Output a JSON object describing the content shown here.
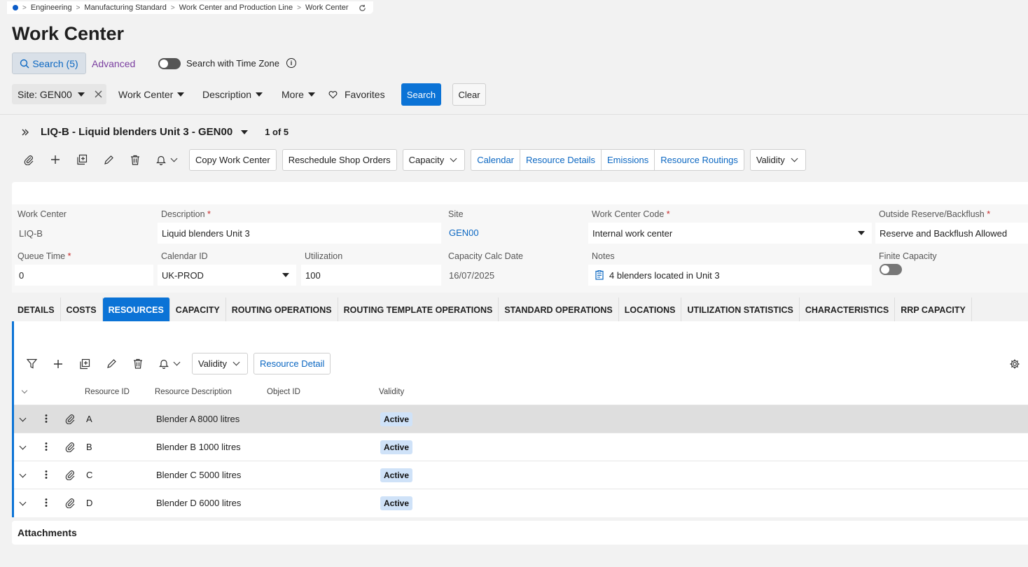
{
  "breadcrumb": [
    "Engineering",
    "Manufacturing Standard",
    "Work Center and Production Line",
    "Work Center"
  ],
  "page_title": "Work Center",
  "search": {
    "search_tab": "Search (5)",
    "advanced": "Advanced",
    "timezone_label": "Search with Time Zone",
    "info": "i"
  },
  "filters": {
    "site_chip": "Site: GEN00",
    "work_center": "Work Center",
    "description": "Description",
    "more": "More",
    "favorites": "Favorites",
    "search_btn": "Search",
    "clear_btn": "Clear"
  },
  "record": {
    "title": "LIQ-B - Liquid blenders Unit 3 - GEN00",
    "count": "1 of 5"
  },
  "toolbar": {
    "copy_work_center": "Copy Work Center",
    "reschedule": "Reschedule Shop Orders",
    "capacity": "Capacity",
    "links": [
      "Calendar",
      "Resource Details",
      "Emissions",
      "Resource Routings"
    ],
    "validity": "Validity"
  },
  "form": {
    "work_center": {
      "label": "Work Center",
      "value": "LIQ-B"
    },
    "description": {
      "label": "Description",
      "value": "Liquid blenders Unit 3"
    },
    "site": {
      "label": "Site",
      "value": "GEN00"
    },
    "work_center_code": {
      "label": "Work Center Code",
      "value": "Internal work center"
    },
    "outside_reserve": {
      "label": "Outside Reserve/Backflush",
      "value": "Reserve and Backflush Allowed"
    },
    "queue_time": {
      "label": "Queue Time",
      "value": "0"
    },
    "calendar_id": {
      "label": "Calendar ID",
      "value": "UK-PROD"
    },
    "utilization": {
      "label": "Utilization",
      "value": "100"
    },
    "capacity_calc_date": {
      "label": "Capacity Calc Date",
      "value": "16/07/2025"
    },
    "notes": {
      "label": "Notes",
      "value": "4 blenders located in Unit 3"
    },
    "finite_capacity": {
      "label": "Finite Capacity",
      "value": false
    }
  },
  "tabs": [
    "DETAILS",
    "COSTS",
    "RESOURCES",
    "CAPACITY",
    "ROUTING OPERATIONS",
    "ROUTING TEMPLATE OPERATIONS",
    "STANDARD OPERATIONS",
    "LOCATIONS",
    "UTILIZATION STATISTICS",
    "CHARACTERISTICS",
    "RRP CAPACITY"
  ],
  "active_tab": "RESOURCES",
  "resources": {
    "validity": "Validity",
    "resource_detail": "Resource Detail",
    "columns": [
      "Resource ID",
      "Resource Description",
      "Object ID",
      "Validity"
    ],
    "rows": [
      {
        "id": "A",
        "description": "Blender A 8000 litres",
        "object_id": "",
        "validity": "Active"
      },
      {
        "id": "B",
        "description": "Blender B 1000 litres",
        "object_id": "",
        "validity": "Active"
      },
      {
        "id": "C",
        "description": "Blender C 5000 litres",
        "object_id": "",
        "validity": "Active"
      },
      {
        "id": "D",
        "description": "Blender D 6000 litres",
        "object_id": "",
        "validity": "Active"
      }
    ]
  },
  "attachments": "Attachments",
  "colors": {
    "primary": "#0b73d6",
    "link": "#0b67c2",
    "advanced": "#7b3fa0",
    "badge": "#cfe2f8"
  }
}
